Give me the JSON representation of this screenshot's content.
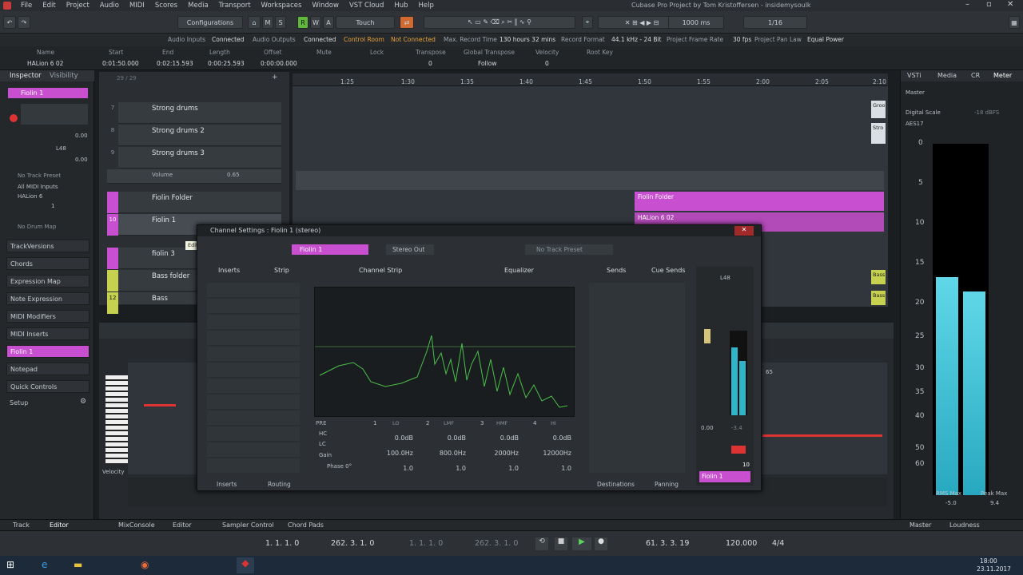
{
  "window": {
    "title": "Cubase Pro Project by Tom Kristoffersen - insidemysoulk",
    "menu": [
      "File",
      "Edit",
      "Project",
      "Audio",
      "MIDI",
      "Scores",
      "Media",
      "Transport",
      "Workspaces",
      "Window",
      "VST Cloud",
      "Hub",
      "Help"
    ]
  },
  "toolbar": {
    "configurations": "Configurations",
    "touch": "Touch",
    "mode_letters": [
      "M",
      "S",
      "R",
      "W",
      "A"
    ],
    "grid": "1000 ms",
    "quantize": "1/16"
  },
  "infoline": {
    "audio_inputs_label": "Audio Inputs",
    "audio_inputs_value": "Connected",
    "audio_outputs_label": "Audio Outputs",
    "audio_outputs_value": "Connected",
    "control_room_label": "Control Room",
    "control_room_value": "Not Connected",
    "max_record_label": "Max. Record Time",
    "max_record_value": "130 hours 32 mins",
    "record_format_label": "Record Format",
    "record_format_value": "44.1 kHz - 24 Bit",
    "frame_rate_label": "Project Frame Rate",
    "frame_rate_value": "30 fps",
    "pan_law_label": "Project Pan Law",
    "pan_law_value": "Equal Power"
  },
  "eventline": {
    "name_h": "Name",
    "name_v": "HALion 6 02",
    "start_h": "Start",
    "start_v": "0:01:50.000",
    "end_h": "End",
    "end_v": "0:02:15.593",
    "length_h": "Length",
    "length_v": "0:00:25.593",
    "offset_h": "Offset",
    "offset_v": "0:00:00.000",
    "mute_h": "Mute",
    "lock_h": "Lock",
    "transpose_h": "Transpose",
    "transpose_v": "0",
    "global_transpose_h": "Global Transpose",
    "global_transpose_v": "Follow",
    "velocity_h": "Velocity",
    "velocity_v": "0",
    "root_key_h": "Root Key"
  },
  "inspector": {
    "tab_inspector": "Inspector",
    "tab_visibility": "Visibility",
    "track_name": "Fiolin 1",
    "value_top": "0.00",
    "pan": "L48",
    "value_bottom": "0.00",
    "no_track_preset": "No Track Preset",
    "midi_input": "All MIDI Inputs",
    "output": "HALion 6",
    "channel": "1",
    "no_drum_map": "No Drum Map",
    "sections": [
      "TrackVersions",
      "Chords",
      "Expression Map",
      "Note Expression",
      "MIDI Modifiers",
      "MIDI Inserts",
      "Fiolin 1",
      "Notepad",
      "Quick Controls"
    ],
    "setup": "Setup"
  },
  "tracks": {
    "header": "29 / 29",
    "items": [
      {
        "num": "7",
        "name": "Strong drums"
      },
      {
        "num": "8",
        "name": "Strong drums 2"
      },
      {
        "num": "9",
        "name": "Strong drums 3"
      },
      {
        "num": "",
        "name": "Volume"
      },
      {
        "num": "",
        "name": "Fiolin Folder"
      },
      {
        "num": "10",
        "name": "Fiolin 1"
      },
      {
        "num": "",
        "name": "MIDIChannels"
      },
      {
        "num": "",
        "name": "fiolin 3"
      },
      {
        "num": "",
        "name": "Bass folder"
      },
      {
        "num": "12",
        "name": "Bass"
      }
    ],
    "volume_value": "0.65",
    "tooltip": "Edit Channel Settings"
  },
  "ruler": {
    "marks": [
      "1:25",
      "1:30",
      "1:35",
      "1:40",
      "1:45",
      "1:50",
      "1:55",
      "2:00",
      "2:05",
      "2:10"
    ]
  },
  "parts": {
    "folder": "Fiolin Folder",
    "halion": "HALion 6 02",
    "right_labels": [
      "Groo",
      "Stro",
      "Bass",
      "Bass"
    ]
  },
  "channel_window": {
    "title": "Channel Settings : Fiolin 1 (stereo)",
    "track": "Fiolin 1",
    "output": "Stereo Out",
    "preset": "No Track Preset",
    "panes": {
      "inserts": "Inserts",
      "strip": "Strip",
      "channel_strip": "Channel Strip",
      "equalizer": "Equalizer",
      "sends": "Sends",
      "cue_sends": "Cue Sends"
    },
    "eq": {
      "pre": "PRE",
      "bands": [
        "1",
        "LO",
        "2",
        "LMF",
        "3",
        "HMF",
        "4",
        "HI"
      ],
      "hc": "HC",
      "lc": "LC",
      "gain": "Gain",
      "phase": "Phase 0°",
      "gains": [
        "0.0dB",
        "0.0dB",
        "0.0dB",
        "0.0dB"
      ],
      "freqs": [
        "100.0Hz",
        "800.0Hz",
        "2000Hz",
        "12000Hz"
      ],
      "qs": [
        "1.0",
        "1.0",
        "1.0",
        "1.0"
      ],
      "axis_x": [
        "20",
        "50",
        "100",
        "200",
        "500",
        "1k",
        "2k",
        "5k",
        "10k",
        "20k"
      ]
    },
    "fader": {
      "pan": "L48",
      "volume": "0.00",
      "peak": "-3.4",
      "number": "10",
      "name": "Fiolin 1"
    },
    "footer": {
      "inserts": "Inserts",
      "routing": "Routing",
      "destinations": "Destinations",
      "panning": "Panning"
    }
  },
  "lower_zone": {
    "velocity_label": "Velocity",
    "marker": "65"
  },
  "right_zone": {
    "tabs": [
      "VSTi",
      "Media",
      "CR",
      "Meter"
    ],
    "master": "Master",
    "digital_scale": "Digital Scale",
    "scale_value": "-18 dBFS",
    "standard": "AES17",
    "scale": [
      "0",
      "5",
      "10",
      "15",
      "20",
      "25",
      "30",
      "35",
      "40",
      "50",
      "60"
    ],
    "rms_label": "RMS Max",
    "rms_value": "-5.0",
    "peak_label": "Peak Max",
    "peak_value": "9.4",
    "meter_left_level": 0.62,
    "meter_right_level": 0.58
  },
  "statusbar": {
    "track": "Track",
    "editor": "Editor",
    "mixconsole": "MixConsole",
    "editor2": "Editor",
    "sampler": "Sampler Control",
    "chord_pads": "Chord Pads",
    "master": "Master",
    "loudness": "Loudness"
  },
  "transport": {
    "left_locator": "1. 1. 1. 0",
    "right_locator": "262. 3. 1. 0",
    "punch_in": "1. 1. 1. 0",
    "punch_out": "262. 3. 1. 0",
    "position": "61. 3. 3. 19",
    "tempo": "120.000",
    "signature": "4/4"
  },
  "taskbar": {
    "time": "18:00",
    "date": "23.11.2017"
  }
}
